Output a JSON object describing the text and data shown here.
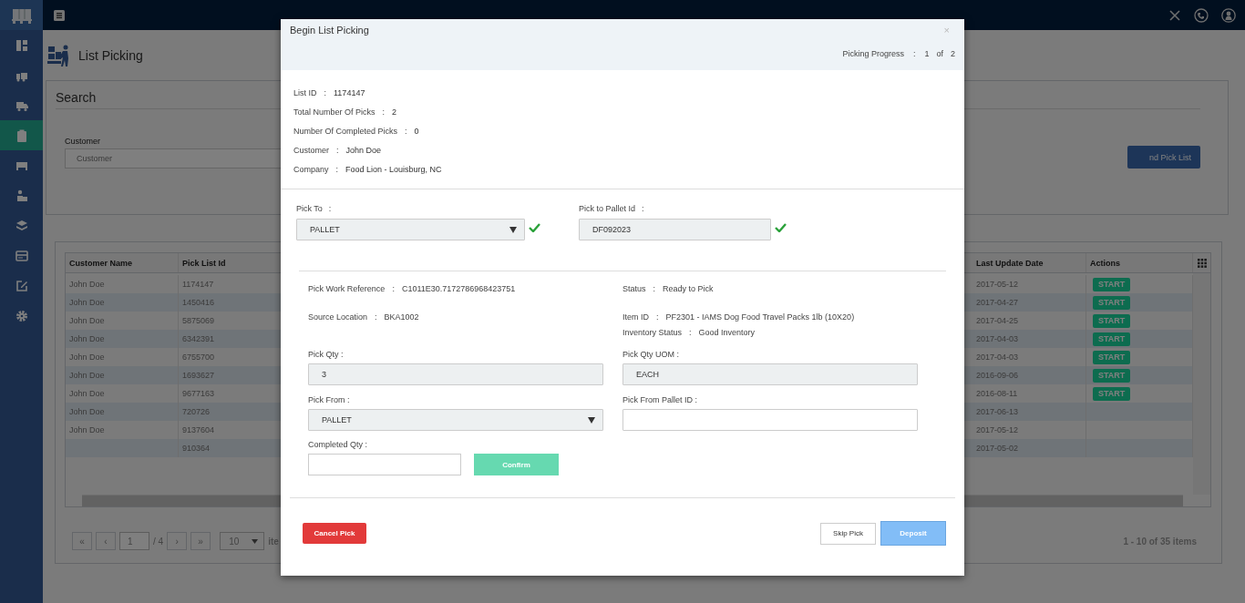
{
  "page_title": "List Picking",
  "sidebar": {
    "items": [
      {
        "selected": false
      },
      {
        "selected": false
      },
      {
        "selected": false
      },
      {
        "selected": true
      },
      {
        "selected": false
      },
      {
        "selected": false
      },
      {
        "selected": false
      },
      {
        "selected": false
      },
      {
        "selected": false
      },
      {
        "selected": false
      }
    ]
  },
  "search": {
    "title": "Search",
    "customer": {
      "label": "Customer",
      "placeholder": "Customer"
    },
    "button": "nd Pick List"
  },
  "table": {
    "columns": [
      "Customer Name",
      "Pick List Id",
      "Last Update Date",
      "Actions"
    ],
    "rows": [
      {
        "customer_name": "John Doe",
        "pick_list_id": "1174147",
        "last_update_date": "2017-05-12",
        "action": "START"
      },
      {
        "customer_name": "John Doe",
        "pick_list_id": "1450416",
        "last_update_date": "2017-04-27",
        "action": "START"
      },
      {
        "customer_name": "John Doe",
        "pick_list_id": "5875069",
        "last_update_date": "2017-04-25",
        "action": "START"
      },
      {
        "customer_name": "John Doe",
        "pick_list_id": "6342391",
        "last_update_date": "2017-04-03",
        "action": "START"
      },
      {
        "customer_name": "John Doe",
        "pick_list_id": "6755700",
        "last_update_date": "2017-04-03",
        "action": "START"
      },
      {
        "customer_name": "John Doe",
        "pick_list_id": "1693627",
        "last_update_date": "2016-09-06",
        "action": "START"
      },
      {
        "customer_name": "John Doe",
        "pick_list_id": "9677163",
        "last_update_date": "2016-08-11",
        "action": "START"
      },
      {
        "customer_name": "John Doe",
        "pick_list_id": "720726",
        "last_update_date": "2017-06-13"
      },
      {
        "customer_name": "John Doe",
        "pick_list_id": "9137604",
        "last_update_date": "2017-05-12"
      },
      {
        "pick_list_id": "910364",
        "last_update_date": "2017-05-02"
      }
    ]
  },
  "pager": {
    "first": "«",
    "prev": "‹",
    "page": "1",
    "total": "/ 4",
    "next": "›",
    "last": "»",
    "page_size": "10",
    "items_label": "ite",
    "summary": "1 - 10 of 35 items"
  },
  "modal": {
    "title": "Begin List Picking",
    "close": "×",
    "progress": {
      "label": "Picking Progress",
      "colon": ":",
      "current": "1",
      "of": "of",
      "total": "2"
    },
    "info": [
      {
        "label": "List ID",
        "colon": ":",
        "value": "1174147"
      },
      {
        "label": "Total Number Of Picks",
        "colon": ":",
        "value": "2"
      },
      {
        "label": "Number Of Completed Picks",
        "colon": ":",
        "value": "0"
      },
      {
        "label": "Customer",
        "colon": ":",
        "value": "John Doe"
      },
      {
        "label": "Company",
        "colon": ":",
        "value": "Food Lion - Louisburg, NC"
      }
    ],
    "pick_to": [
      {
        "kind": "select",
        "label": "Pick To",
        "colon": ":",
        "value": "PALLET",
        "valid": true
      },
      {
        "kind": "input",
        "label": "Pick to Pallet Id",
        "colon": ":",
        "value": "DF092023",
        "valid": true
      }
    ],
    "details_left": [
      {
        "label": "Pick Work Reference",
        "colon": ":",
        "value": "C1011E30.7172786968423751"
      },
      {
        "label": "Source Location",
        "colon": ":",
        "value": "BKA1002"
      }
    ],
    "details_right": [
      {
        "label": "Status",
        "colon": ":",
        "value": "Ready to Pick"
      },
      {
        "label": "Item ID",
        "colon": ":",
        "value": "PF2301 - IAMS Dog Food Travel Packs 1lb (10X20)"
      },
      {
        "label": "Inventory Status",
        "colon": ":",
        "value": "Good Inventory"
      }
    ],
    "fields": [
      {
        "kind": "input",
        "label": "Pick Qty :",
        "value": "3",
        "readonly": true
      },
      {
        "kind": "input",
        "label": "Pick Qty UOM :",
        "value": "EACH",
        "readonly": true
      },
      {
        "kind": "select",
        "label": "Pick From :",
        "value": "PALLET",
        "readonly": true
      },
      {
        "kind": "input",
        "label": "Pick From Pallet ID :",
        "readonly": false
      }
    ],
    "completed": {
      "label": "Completed Qty :",
      "confirm": "Confirm",
      "confirm_disabled": true
    },
    "buttons": {
      "cancel": "Cancel Pick",
      "skip": "Skip Pick",
      "deposit": "Deposit",
      "deposit_disabled": true
    }
  }
}
